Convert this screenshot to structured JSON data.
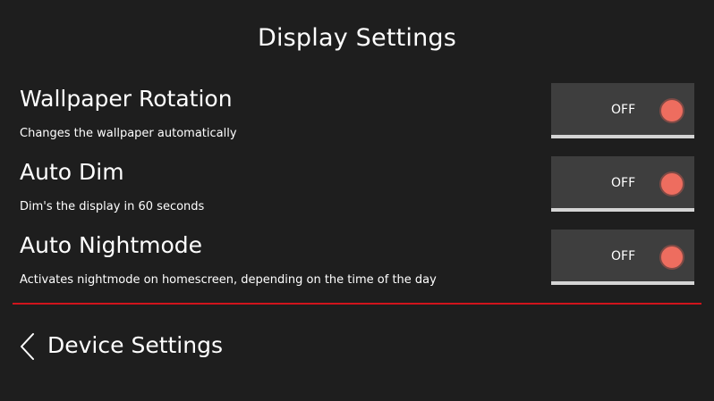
{
  "page": {
    "title": "Display Settings"
  },
  "settings": [
    {
      "title": "Wallpaper Rotation",
      "description": "Changes the wallpaper automatically",
      "toggle": {
        "state_label": "OFF",
        "on": false
      }
    },
    {
      "title": "Auto Dim",
      "description": "Dim's the display in 60 seconds",
      "toggle": {
        "state_label": "OFF",
        "on": false
      }
    },
    {
      "title": "Auto Nightmode",
      "description": "Activates nightmode on homescreen, depending on the time of the day",
      "toggle": {
        "state_label": "OFF",
        "on": false
      }
    }
  ],
  "nav": {
    "back_label": "Device Settings",
    "back_icon": "chevron-left-icon"
  },
  "colors": {
    "background": "#1e1e1e",
    "toggle_background": "#3e3e3e",
    "toggle_knob_off": "#ee6d5f",
    "divider": "#d0141c",
    "toggle_underline": "#d4d4d4"
  }
}
